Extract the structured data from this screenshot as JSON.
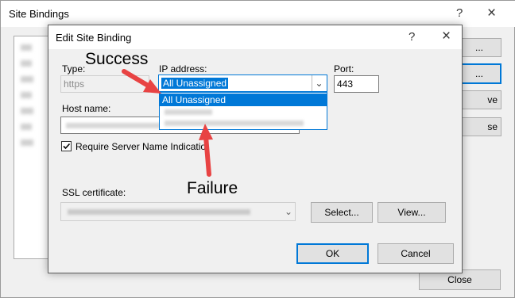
{
  "background_window": {
    "title": "Site Bindings",
    "help_glyph": "?",
    "close_glyph": "×",
    "buttons": {
      "add": "...",
      "edit": "...",
      "remove": "ve",
      "browse": "se",
      "close": "Close"
    }
  },
  "dialog": {
    "title": "Edit Site Binding",
    "help_glyph": "?",
    "close_glyph": "×",
    "type_label": "Type:",
    "type_value": "https",
    "ip_label": "IP address:",
    "ip_value": "All Unassigned",
    "ip_options": [
      "All Unassigned"
    ],
    "port_label": "Port:",
    "port_value": "443",
    "host_label": "Host name:",
    "sni_label": "Require Server Name Indicatio",
    "sni_checked": true,
    "ssl_label": "SSL certificate:",
    "select_button": "Select...",
    "view_button": "View...",
    "ok_button": "OK",
    "cancel_button": "Cancel"
  },
  "annotations": {
    "success": "Success",
    "failure": "Failure",
    "arrow_color": "#e84343"
  },
  "colors": {
    "accent": "#0078d7",
    "dialog_bg": "#f0f0f0"
  }
}
